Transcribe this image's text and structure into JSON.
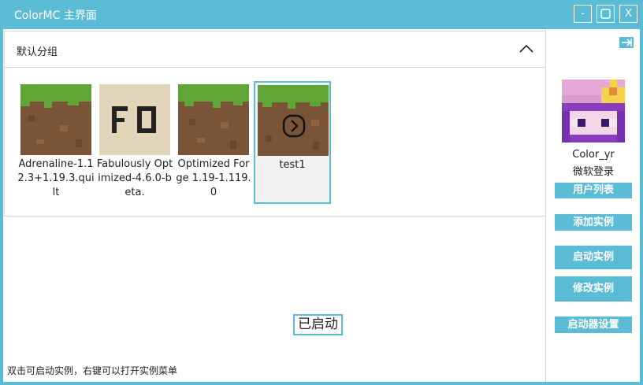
{
  "window": {
    "title": "ColorMC 主界面",
    "minimize_label": "-",
    "maximize_label": "☐",
    "close_label": "X"
  },
  "group": {
    "title": "默认分组"
  },
  "instances": [
    {
      "name": "Adrenaline-1.12.3+1.19.3.quilt",
      "icon": "grass-block-icon"
    },
    {
      "name": "Fabulously Optimized-4.6.0-beta.",
      "icon": "fo-logo-icon"
    },
    {
      "name": "Optimized Forge 1.19-1.119.0",
      "icon": "grass-block-icon"
    },
    {
      "name": "test1",
      "icon": "grass-block-icon",
      "selected": true
    }
  ],
  "status": {
    "text": "已启动"
  },
  "hint": {
    "text": "双击可启动实例，右键可以打开实例菜单"
  },
  "sidebar": {
    "toggle_icon": "arrow-right-icon",
    "username": "Color_yr",
    "login_type": "微软登录",
    "buttons": {
      "user_list": "用户列表",
      "add_instance": "添加实例",
      "launch_instance": "启动实例",
      "edit_instance": "修改实例",
      "launcher_settings": "启动器设置"
    }
  },
  "colors": {
    "accent": "#5bbcd6",
    "grass": "#5fa636",
    "dirt": "#7a5437"
  }
}
